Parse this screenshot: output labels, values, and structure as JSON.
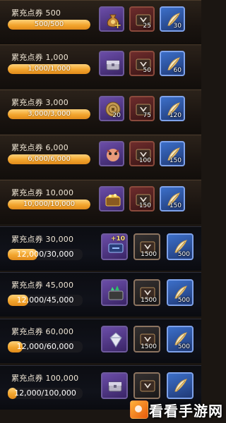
{
  "row_label": "累充点券",
  "watermark": "看看手游网",
  "rows": [
    {
      "threshold": "500",
      "progress": "500/500",
      "fill_fraction": 1.0,
      "items": [
        {
          "icon": "money-bag-icon",
          "count": "",
          "plus": "+"
        },
        {
          "icon": "wolf-crest-chest-icon",
          "count": "25"
        },
        {
          "icon": "golden-wing-feather-icon",
          "count": "30"
        }
      ]
    },
    {
      "threshold": "1,000",
      "progress": "1,000/1,000",
      "fill_fraction": 1.0,
      "items": [
        {
          "icon": "silver-chest-icon",
          "count": ""
        },
        {
          "icon": "wolf-crest-chest-icon",
          "count": "50"
        },
        {
          "icon": "golden-wing-feather-icon",
          "count": "60"
        }
      ]
    },
    {
      "threshold": "3,000",
      "progress": "3,000/3,000",
      "fill_fraction": 1.0,
      "items": [
        {
          "icon": "bronze-coin-icon",
          "count": "20"
        },
        {
          "icon": "wolf-crest-chest-icon",
          "count": "75"
        },
        {
          "icon": "golden-wing-feather-icon",
          "count": "120"
        }
      ]
    },
    {
      "threshold": "6,000",
      "progress": "6,000/6,000",
      "fill_fraction": 1.0,
      "items": [
        {
          "icon": "pet-creature-icon",
          "count": ""
        },
        {
          "icon": "wolf-crest-chest-icon",
          "count": "100"
        },
        {
          "icon": "golden-wing-feather-icon",
          "count": "150"
        }
      ]
    },
    {
      "threshold": "10,000",
      "progress": "10,000/10,000",
      "fill_fraction": 1.0,
      "items": [
        {
          "icon": "gold-treasure-chest-icon",
          "count": ""
        },
        {
          "icon": "wolf-crest-chest-icon",
          "count": "150"
        },
        {
          "icon": "golden-wing-feather-icon",
          "count": "150"
        }
      ]
    },
    {
      "threshold": "30,000",
      "progress": "12,000/30,000",
      "fill_fraction": 0.4,
      "items": [
        {
          "icon": "upgrade-scroll-icon",
          "count": "",
          "badge": "+10"
        },
        {
          "icon": "wolf-crest-chest-icon",
          "count": "1500"
        },
        {
          "icon": "golden-wing-feather-icon",
          "count": "500"
        }
      ]
    },
    {
      "threshold": "45,000",
      "progress": "12,000/45,000",
      "fill_fraction": 0.27,
      "items": [
        {
          "icon": "jade-chest-icon",
          "count": ""
        },
        {
          "icon": "wolf-crest-chest-icon",
          "count": "1500"
        },
        {
          "icon": "golden-wing-feather-icon",
          "count": "500"
        }
      ]
    },
    {
      "threshold": "60,000",
      "progress": "12,000/60,000",
      "fill_fraction": 0.2,
      "items": [
        {
          "icon": "diamond-gem-icon",
          "count": ""
        },
        {
          "icon": "wolf-crest-chest-icon",
          "count": "1500"
        },
        {
          "icon": "golden-wing-feather-icon",
          "count": "500"
        }
      ]
    },
    {
      "threshold": "100,000",
      "progress": "12,000/100,000",
      "fill_fraction": 0.12,
      "items": [
        {
          "icon": "silver-chest-icon",
          "count": ""
        },
        {
          "icon": "wolf-crest-chest-icon",
          "count": ""
        },
        {
          "icon": "golden-wing-feather-icon",
          "count": ""
        }
      ]
    }
  ]
}
